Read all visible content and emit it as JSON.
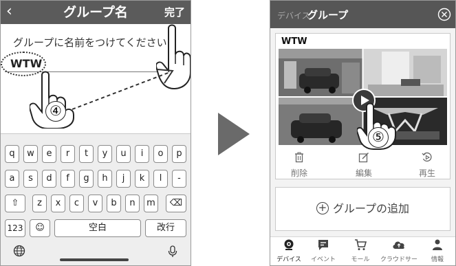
{
  "left_screen": {
    "back_icon": "chevron-left-icon",
    "title": "グループ名",
    "done_label": "完了",
    "prompt": "グループに名前をつけてください",
    "input_value": "WTW",
    "step_number": "④",
    "keyboard": {
      "row1": [
        "q",
        "w",
        "e",
        "r",
        "t",
        "y",
        "u",
        "i",
        "o",
        "p"
      ],
      "row2": [
        "a",
        "s",
        "d",
        "f",
        "g",
        "h",
        "j",
        "k",
        "l",
        "-"
      ],
      "row3": [
        "z",
        "x",
        "c",
        "v",
        "b",
        "n",
        "m"
      ],
      "shift_icon": "shift-arrow-icon",
      "delete_icon": "backspace-icon",
      "numbers_label": "123",
      "emoji_icon": "emoji-icon",
      "space_label": "空白",
      "return_label": "改行",
      "globe_icon": "globe-icon",
      "mic_icon": "microphone-icon"
    }
  },
  "right_screen": {
    "tab_device": "デバイス",
    "tab_group": "グループ",
    "close_icon": "close-circle-icon",
    "group_card": {
      "name": "WTW",
      "play_icon": "play-icon",
      "step_number": "⑤",
      "actions": [
        {
          "label": "削除",
          "icon": "trash-icon"
        },
        {
          "label": "編集",
          "icon": "edit-icon"
        },
        {
          "label": "再生",
          "icon": "replay-icon"
        }
      ]
    },
    "add_group_label": "グループの追加",
    "bottom_nav": [
      {
        "label": "デバイス",
        "icon": "camera-icon"
      },
      {
        "label": "イベント",
        "icon": "message-icon"
      },
      {
        "label": "モール",
        "icon": "cart-icon"
      },
      {
        "label": "クラウドサー",
        "icon": "cloud-icon"
      },
      {
        "label": "情報",
        "icon": "person-icon"
      }
    ]
  },
  "colors": {
    "header_bg": "#5b5b5b",
    "active_nav": "#222222",
    "inactive_text": "#777777"
  }
}
